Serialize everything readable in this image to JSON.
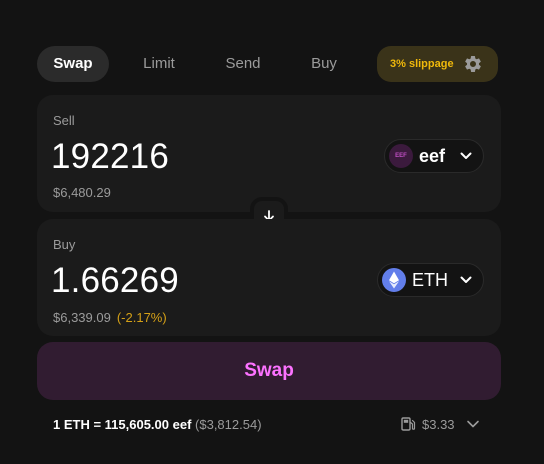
{
  "tabs": [
    {
      "label": "Swap",
      "active": true
    },
    {
      "label": "Limit",
      "active": false
    },
    {
      "label": "Send",
      "active": false
    },
    {
      "label": "Buy",
      "active": false
    }
  ],
  "slippage": {
    "label": "3% slippage",
    "icon": "gear-icon"
  },
  "sell": {
    "label": "Sell",
    "amount": "192216",
    "usd": "$6,480.29",
    "token": {
      "symbol": "eef",
      "icon_text": "EEF",
      "icon": "eef-token-icon"
    }
  },
  "buy": {
    "label": "Buy",
    "amount": "1.66269",
    "usd": "$6,339.09",
    "change": "(-2.17%)",
    "token": {
      "symbol": "ETH",
      "icon": "eth-token-icon"
    }
  },
  "swap_button": {
    "label": "Swap"
  },
  "footer": {
    "rate": "1 ETH = 115,605.00 eef",
    "rate_usd": "($3,812.54)",
    "gas": "$3.33"
  },
  "colors": {
    "background": "#131313",
    "panel": "#1b1b1b",
    "accent_pink": "#fc72ff",
    "slippage_yellow": "#f0b90b",
    "warning": "#d4a017"
  }
}
